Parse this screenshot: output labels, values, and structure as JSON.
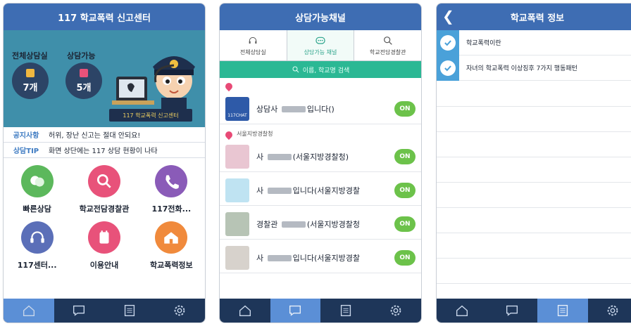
{
  "screen1": {
    "title": "117 학교폭력 신고센터",
    "counselors_label": "전체상담실",
    "counselors_count": "7개",
    "available_label": "상담가능",
    "available_count": "5개",
    "sign_text": "117 학교폭력 신고센터",
    "notice_tag": "공지사항",
    "notice_text": "허위, 장난 신고는 절대 안되요!",
    "tip_tag": "상담TIP",
    "tip_text": "화면 상단에는 117 상담 현황이 나타",
    "menu": [
      {
        "label": "빠른상담",
        "color": "#5cb85c",
        "icon": "chat-bubbles-icon"
      },
      {
        "label": "학교전담경찰관",
        "color": "#e8527a",
        "icon": "search-icon"
      },
      {
        "label": "117전화...",
        "color": "#8a5bb8",
        "icon": "phone-icon"
      },
      {
        "label": "117센터...",
        "color": "#5b6fb8",
        "icon": "headset-icon"
      },
      {
        "label": "이용안내",
        "color": "#e8527a",
        "icon": "notepad-icon"
      },
      {
        "label": "학교폭력정보",
        "color": "#f08a3c",
        "icon": "house-icon"
      }
    ]
  },
  "screen2": {
    "title": "상담가능채널",
    "segments": [
      "전체상담실",
      "상담가능 채널",
      "학교전담경찰관"
    ],
    "search_placeholder": "이름, 학교명 검색",
    "on_label": "ON",
    "group_label": "서울지방경찰청",
    "rows": [
      {
        "prefix": "상담사",
        "suffix": "입니다()",
        "avatar_text": "117CHAT"
      },
      {
        "prefix": "사",
        "suffix": "(서울지방경찰청)",
        "avatar_text": ""
      },
      {
        "prefix": "사",
        "suffix": "입니다(서울지방경찰",
        "avatar_text": ""
      },
      {
        "prefix": "경찰관",
        "suffix": "(서울지방경찰청",
        "avatar_text": ""
      },
      {
        "prefix": "사",
        "suffix": "입니다(서울지방경찰",
        "avatar_text": ""
      }
    ]
  },
  "screen3": {
    "title": "학교폭력 정보",
    "items": [
      "학교폭력이란",
      "자녀의 학교폭력 이상징후 7가지 행동패턴"
    ]
  },
  "colors": {
    "header": "#3e6db3",
    "tabbar": "#1e3659",
    "tab_active": "#5b8fd6",
    "accent_green": "#2bb894",
    "on_badge": "#6cc24a"
  },
  "tabbar_icons": [
    "home-icon",
    "chat-icon",
    "list-icon",
    "settings-icon"
  ]
}
